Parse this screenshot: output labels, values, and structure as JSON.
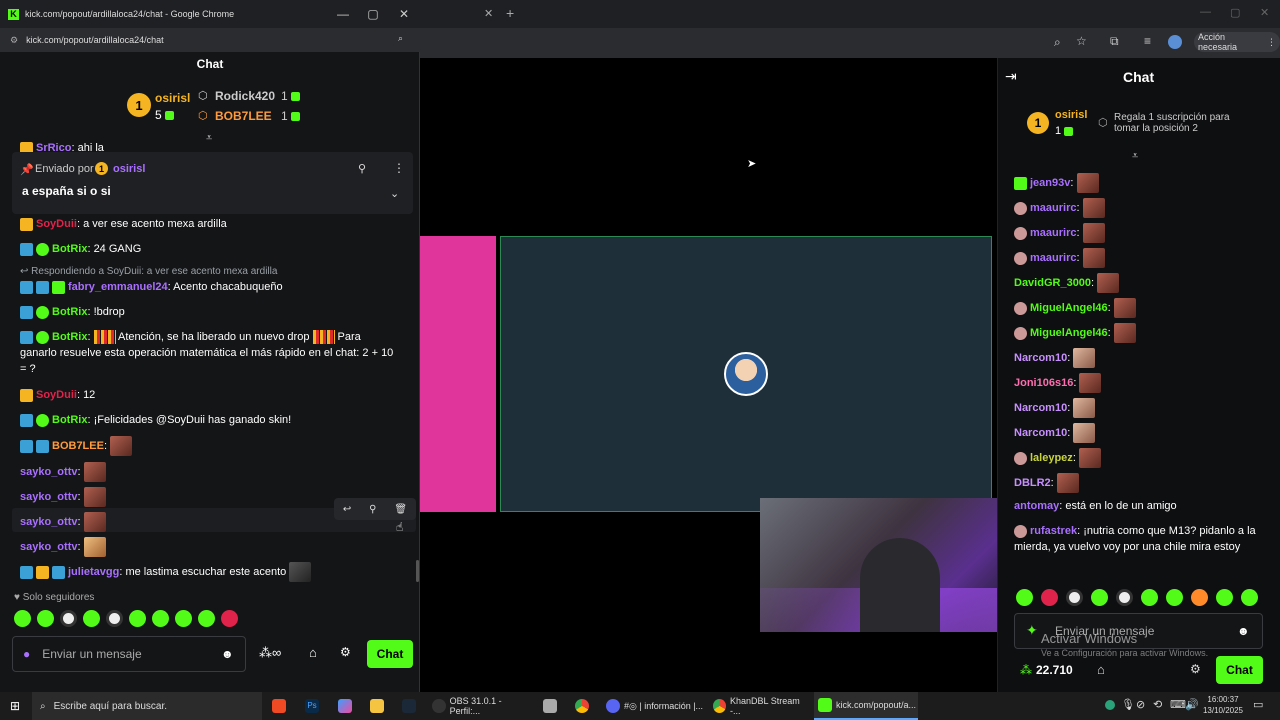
{
  "popout": {
    "window_title": "kick.com/popout/ardillaloca24/chat - Google Chrome",
    "url": "kick.com/popout/ardillaloca24/chat",
    "chat_header": "Chat",
    "leaderboard": {
      "first": {
        "rank": "1",
        "name": "osirisl",
        "count": "5"
      },
      "second": {
        "name": "Rodick420",
        "count": "1"
      },
      "third": {
        "name": "BOB7LEE",
        "count": "1"
      }
    },
    "cutoff_user": "SrRico",
    "cutoff_text": ": ahi la",
    "pinned": {
      "sent_by_label": "Enviado por",
      "rank": "1",
      "user": "osirisl",
      "text": "a españa si o si"
    },
    "messages": [
      {
        "user": "SoyDuii",
        "text": ": a ver ese acento mexa ardilla"
      },
      {
        "user": "BotRix",
        "text": ": 24 GANG"
      },
      {
        "reply": "Respondiendo a SoyDuii: a ver ese acento mexa ardilla"
      },
      {
        "user": "fabry_emmanuel24",
        "text": ": Acento chacabuqueño"
      },
      {
        "user": "BotRix",
        "text": ": !bdrop"
      },
      {
        "user": "BotRix",
        "text_a": ": ",
        "text_b": " Atención, se ha liberado un nuevo drop ",
        "text_c": " Para ganarlo resuelve esta operación matemática el más rápido en el chat: 2 + 10 = ?"
      },
      {
        "user": "SoyDuii",
        "text": ": 12"
      },
      {
        "user": "BotRix",
        "text": ": ¡Felicidades @SoyDuii has ganado skin!"
      },
      {
        "user": "BOB7LEE",
        "text": ":"
      },
      {
        "user": "sayko_ottv",
        "text": ":"
      },
      {
        "user": "sayko_ottv",
        "text": ":"
      },
      {
        "user": "sayko_ottv",
        "text": ":"
      },
      {
        "user": "sayko_ottv",
        "text": ":"
      },
      {
        "user": "julietavgg",
        "text": ": me lastima escuchar este acento"
      }
    ],
    "followers_only": "Solo seguidores",
    "input_placeholder": "Enviar un mensaje",
    "chat_button": "Chat"
  },
  "right_chat": {
    "header": "Chat",
    "leader": {
      "rank": "1",
      "name": "osirisl",
      "count": "1"
    },
    "gift_prompt": "Regala 1 suscripción para tomar la posición 2",
    "messages": [
      {
        "user": "jean93v",
        "text": ":"
      },
      {
        "user": "maaurirc",
        "text": ":"
      },
      {
        "user": "maaurirc",
        "text": ":"
      },
      {
        "user": "maaurirc",
        "text": ":"
      },
      {
        "user": "DavidGR_3000",
        "text": ":"
      },
      {
        "user": "MiguelAngel46",
        "text": ":"
      },
      {
        "user": "MiguelAngel46",
        "text": ":"
      },
      {
        "user": "Narcom10",
        "text": ":"
      },
      {
        "user": "Joni106s16",
        "text": ":"
      },
      {
        "user": "Narcom10",
        "text": ":"
      },
      {
        "user": "Narcom10",
        "text": ":"
      },
      {
        "user": "laleypez",
        "text": ":"
      },
      {
        "user": "DBLR2",
        "text": ":"
      },
      {
        "user": "antomay",
        "text": ": está en lo de un amigo"
      },
      {
        "user": "rufastrek",
        "text": ": ¡nutria como que M13? pidanlo a la mierda, ya vuelvo voy por una chile mira estoy"
      }
    ],
    "input_placeholder": "Enviar un mensaje",
    "watermark_title": "Activar Windows",
    "watermark_sub": "Ve a Configuración para activar Windows.",
    "points": "22.710",
    "chat_button": "Chat"
  },
  "bg_browser": {
    "action_needed": "Acción necesaria"
  },
  "taskbar": {
    "search_placeholder": "Escribe aquí para buscar.",
    "apps": [
      {
        "label": "OBS 31.0.1 - Perfil:..."
      },
      {
        "label": "#◎ | información |..."
      },
      {
        "label": "KhanDBL Stream -..."
      },
      {
        "label": "kick.com/popout/a..."
      }
    ],
    "time": "16:00:37",
    "date": "13/10/2025"
  },
  "colors": {
    "accent": "#53fc18",
    "pink": "#e0359a",
    "teal": "#1e2f3a"
  }
}
